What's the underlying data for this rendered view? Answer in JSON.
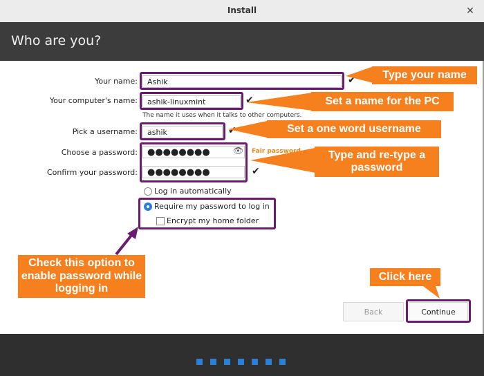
{
  "window": {
    "title": "Install",
    "close_glyph": "✕"
  },
  "header": {
    "title": "Who are you?"
  },
  "form": {
    "name_label": "Your name:",
    "name_value": "Ashik",
    "computer_label": "Your computer's name:",
    "computer_value": "ashik-linuxmint",
    "computer_hint": "The name it uses when it talks to other computers.",
    "username_label": "Pick a username:",
    "username_value": "ashik",
    "password_label": "Choose a password:",
    "password_value": "●●●●●●●●",
    "password_strength": "Fair password",
    "confirm_label": "Confirm your password:",
    "confirm_value": "●●●●●●●●",
    "check_glyph": "✔",
    "eye_glyph": "👁",
    "options": {
      "auto_login": "Log in automatically",
      "require_password": "Require my password to log in",
      "encrypt_home": "Encrypt my home folder",
      "selected": "require_password"
    }
  },
  "buttons": {
    "back": "Back",
    "continue": "Continue"
  },
  "annotations": {
    "type_name": "Type your name",
    "set_pc_name": "Set a name for the PC",
    "set_username": "Set a one word username",
    "type_password": "Type and re-type a password",
    "check_option": "Check this option to enable password while logging in",
    "click_here": "Click here"
  },
  "progress": {
    "steps_total": 7
  },
  "colors": {
    "annotation_orange": "#f7801e",
    "highlight_purple": "#6a1b70",
    "accent_blue": "#2b7fd4"
  }
}
